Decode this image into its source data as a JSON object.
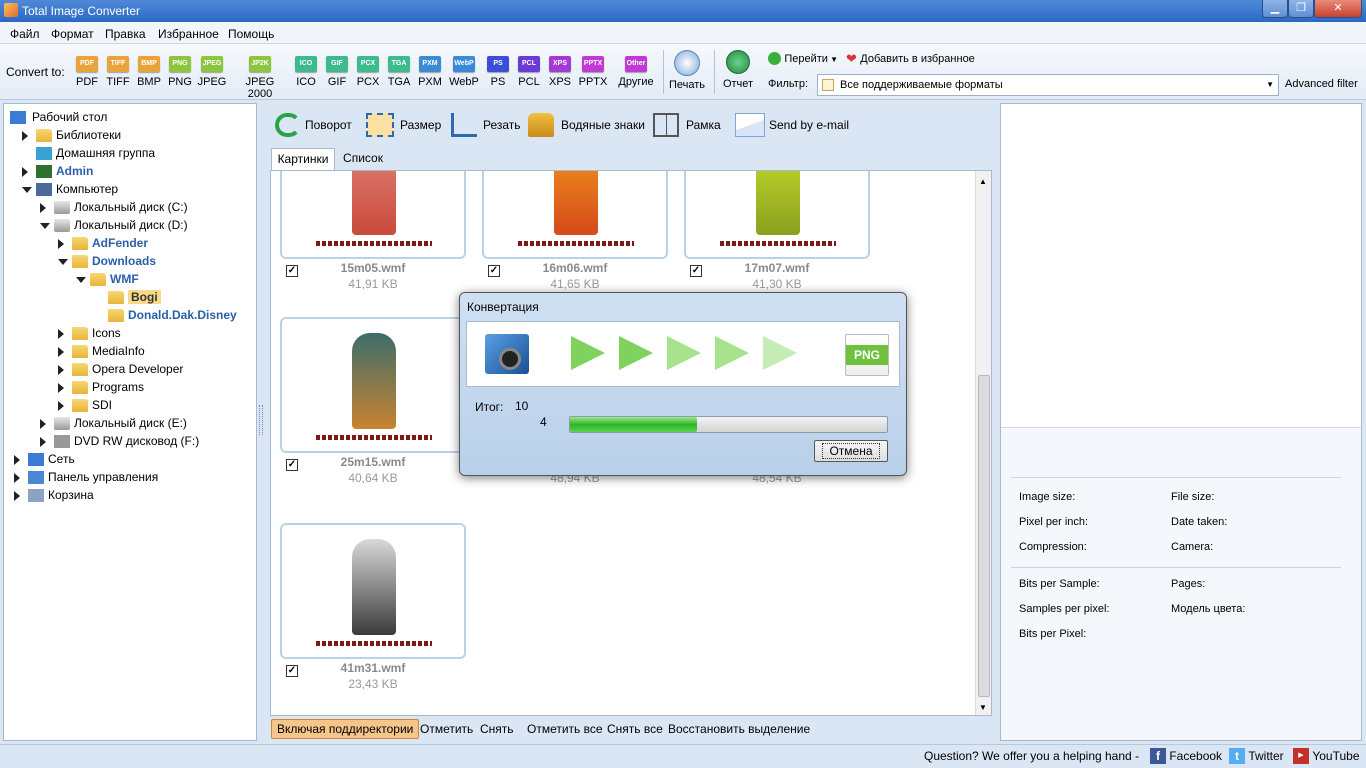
{
  "window": {
    "title": "Total Image Converter"
  },
  "menu": [
    "Файл",
    "Формат",
    "Правка",
    "Избранное",
    "Помощь"
  ],
  "toolbar": {
    "convert_to_label": "Convert to:",
    "formats": [
      {
        "label": "PDF",
        "icon": "PDF",
        "color": "#e8a33a"
      },
      {
        "label": "TIFF",
        "icon": "TIFF",
        "color": "#e8a33a"
      },
      {
        "label": "BMP",
        "icon": "BMP",
        "color": "#e8a33a"
      },
      {
        "label": "PNG",
        "icon": "PNG",
        "color": "#8cc63e"
      },
      {
        "label": "JPEG",
        "icon": "JPEG",
        "color": "#8cc63e"
      },
      {
        "label": "JPEG 2000",
        "icon": "JP2K",
        "color": "#8cc63e"
      },
      {
        "label": "ICO",
        "icon": "ICO",
        "color": "#3dbb8f"
      },
      {
        "label": "GIF",
        "icon": "GIF",
        "color": "#3dbb8f"
      },
      {
        "label": "PCX",
        "icon": "PCX",
        "color": "#3dbb8f"
      },
      {
        "label": "TGA",
        "icon": "TGA",
        "color": "#3dbb8f"
      },
      {
        "label": "PXM",
        "icon": "PXM",
        "color": "#3a8ad6"
      },
      {
        "label": "WebP",
        "icon": "WebP",
        "color": "#3a8ad6"
      },
      {
        "label": "PS",
        "icon": "PS",
        "color": "#3a4fd6"
      },
      {
        "label": "PCL",
        "icon": "PCL",
        "color": "#6a3ad6"
      },
      {
        "label": "XPS",
        "icon": "XPS",
        "color": "#a43ad6"
      },
      {
        "label": "PPTX",
        "icon": "PPTX",
        "color": "#c23ad6"
      },
      {
        "label": "Другие",
        "icon": "Other",
        "color": "#c23ad6"
      }
    ],
    "print_label": "Печать",
    "report_label": "Отчет",
    "goto_label": "Перейти",
    "favorites_label": "Добавить в избранное",
    "filter_label": "Фильтр:",
    "filter_value": "Все поддерживаемые форматы",
    "advanced_filter": "Advanced filter"
  },
  "tree": [
    {
      "label": "Рабочий стол",
      "level": 0,
      "arrow": "none",
      "icon": "desktop",
      "style": "normal"
    },
    {
      "label": "Библиотеки",
      "level": 1,
      "arrow": "right",
      "icon": "folder",
      "style": "normal"
    },
    {
      "label": "Домашняя группа",
      "level": 1,
      "arrow": "none",
      "icon": "homegroup",
      "style": "normal"
    },
    {
      "label": "Admin",
      "level": 1,
      "arrow": "right",
      "icon": "user",
      "style": "bold"
    },
    {
      "label": "Компьютер",
      "level": 1,
      "arrow": "down",
      "icon": "computer",
      "style": "normal"
    },
    {
      "label": "Локальный диск (C:)",
      "level": 2,
      "arrow": "right",
      "icon": "drive",
      "style": "normal"
    },
    {
      "label": "Локальный диск (D:)",
      "level": 2,
      "arrow": "down",
      "icon": "drive",
      "style": "normal"
    },
    {
      "label": "AdFender",
      "level": 3,
      "arrow": "right",
      "icon": "folder",
      "style": "bold"
    },
    {
      "label": "Downloads",
      "level": 3,
      "arrow": "down",
      "icon": "folder",
      "style": "bold"
    },
    {
      "label": "WMF",
      "level": 4,
      "arrow": "down",
      "icon": "folder",
      "style": "bold"
    },
    {
      "label": "Bogi",
      "level": 5,
      "arrow": "none",
      "icon": "folder",
      "style": "selected"
    },
    {
      "label": "Donald.Dak.Disney",
      "level": 5,
      "arrow": "none",
      "icon": "folder",
      "style": "bold"
    },
    {
      "label": "Icons",
      "level": 3,
      "arrow": "right",
      "icon": "folder",
      "style": "normal"
    },
    {
      "label": "MediaInfo",
      "level": 3,
      "arrow": "right",
      "icon": "folder",
      "style": "normal"
    },
    {
      "label": "Opera Developer",
      "level": 3,
      "arrow": "right",
      "icon": "folder",
      "style": "normal"
    },
    {
      "label": "Programs",
      "level": 3,
      "arrow": "right",
      "icon": "folder",
      "style": "normal"
    },
    {
      "label": "SDI",
      "level": 3,
      "arrow": "right",
      "icon": "folder",
      "style": "normal"
    },
    {
      "label": "Локальный диск (E:)",
      "level": 2,
      "arrow": "right",
      "icon": "drive",
      "style": "normal"
    },
    {
      "label": "DVD RW дисковод (F:)",
      "level": 2,
      "arrow": "right",
      "icon": "dvd",
      "style": "normal"
    },
    {
      "label": "Сеть",
      "level": 0,
      "arrow": "right",
      "icon": "network",
      "style": "normal"
    },
    {
      "label": "Панель управления",
      "level": 0,
      "arrow": "right",
      "icon": "control",
      "style": "normal"
    },
    {
      "label": "Корзина",
      "level": 0,
      "arrow": "right",
      "icon": "bin",
      "style": "normal"
    }
  ],
  "actions": {
    "rotate": "Поворот",
    "resize": "Размер",
    "crop": "Резать",
    "watermark": "Водяные знаки",
    "frame": "Рамка",
    "email": "Send by e-mail"
  },
  "tabs": {
    "pictures": "Картинки",
    "list": "Список"
  },
  "thumbs": [
    {
      "name": "15m05.wmf",
      "size": "41,91 KB",
      "checked": true
    },
    {
      "name": "16m06.wmf",
      "size": "41,65 KB",
      "checked": true
    },
    {
      "name": "17m07.wmf",
      "size": "41,30 KB",
      "checked": true
    },
    {
      "name": "25m15.wmf",
      "size": "40,64 KB",
      "checked": true
    },
    {
      "name": "",
      "size": "48,94 KB",
      "checked": true
    },
    {
      "name": "",
      "size": "48,54 KB",
      "checked": true
    },
    {
      "name": "41m31.wmf",
      "size": "23,43 KB",
      "checked": true
    }
  ],
  "bottom": {
    "include_sub": "Включая поддиректории",
    "mark": "Отметить",
    "unmark": "Снять",
    "mark_all": "Отметить все",
    "unmark_all": "Снять все",
    "restore": "Восстановить выделение"
  },
  "info": {
    "image_size": "Image size:",
    "file_size": "File size:",
    "ppi": "Pixel per inch:",
    "date_taken": "Date taken:",
    "compression": "Compression:",
    "camera": "Camera:",
    "bits_sample": "Bits per Sample:",
    "pages": "Pages:",
    "samples_pixel": "Samples per pixel:",
    "color_model": "Модель цвета:",
    "bits_pixel": "Bits per Pixel:"
  },
  "dialog": {
    "title": "Конвертация",
    "target_format": "PNG",
    "total_label": "Итог:",
    "total": "10",
    "current": "4",
    "progress": 0.4,
    "cancel": "Отмена"
  },
  "status": {
    "question": "Question? We offer you a helping hand -",
    "facebook": "Facebook",
    "twitter": "Twitter",
    "youtube": "YouTube"
  },
  "colors": {
    "accent": "#2b5fa8",
    "progress": "#3ec63a",
    "selected_bg": "#f7d98a"
  }
}
